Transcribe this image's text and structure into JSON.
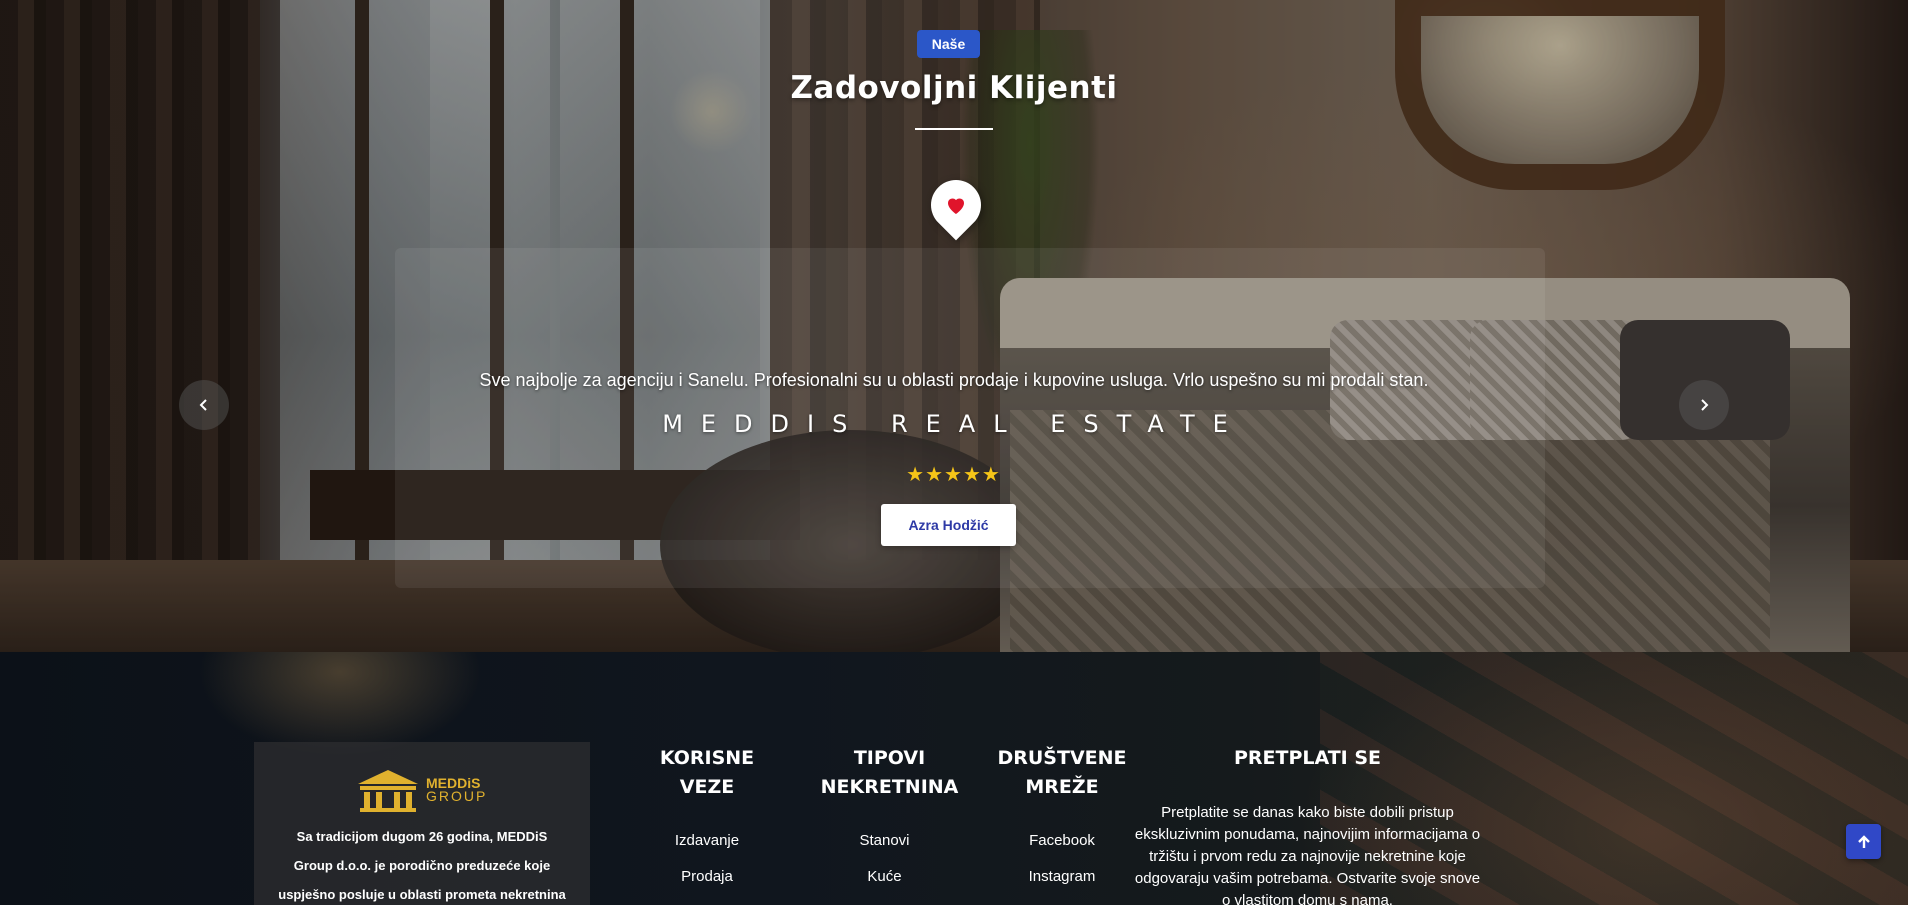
{
  "testimonials": {
    "badge": "Naše",
    "title": "Zadovoljni Klijenti",
    "quote": "Sve najbolje za agenciju i Sanelu. Profesionalni su u oblasti prodaje i kupovine usluga. Vrlo uspešno su mi prodali stan.",
    "company": "MEDDIS REAL ESTATE",
    "rating": 5,
    "stars": [
      "★",
      "★",
      "★",
      "★",
      "★"
    ],
    "client_name": "Azra Hodžić",
    "icons": {
      "heart": "heart-icon",
      "prev": "chevron-left-icon",
      "next": "chevron-right-icon"
    }
  },
  "footer": {
    "logo": {
      "line1": "MEDDiS",
      "line2": "GROUP"
    },
    "about": "Sa tradicijom dugom 26 godina, MEDDiS Group d.o.o. je porodično preduzeće koje uspješno posluje u oblasti prometa nekretnina i",
    "useful_links": {
      "title": "KORISNE VEZE",
      "items": [
        "Izdavanje",
        "Prodaja"
      ]
    },
    "property_types": {
      "title": "TIPOVI NEKRETNINA",
      "items": [
        "Stanovi",
        "Kuće"
      ]
    },
    "social": {
      "title": "DRUŠTVENE MREŽE",
      "items": [
        "Facebook",
        "Instagram"
      ]
    },
    "subscribe": {
      "title": "PRETPLATI SE",
      "text": "Pretplatite se danas kako biste dobili pristup ekskluzivnim ponudama, najnovijim informacijama o tržištu i prvom redu za najnovije nekretnine koje odgovaraju vašim potrebama. Ostvarite svoje snove o vlastitom domu s nama."
    }
  },
  "colors": {
    "accent_blue": "#2b57c8",
    "star_yellow": "#f5c518",
    "heart_red": "#e0142b",
    "logo_gold": "#e0b12e"
  }
}
